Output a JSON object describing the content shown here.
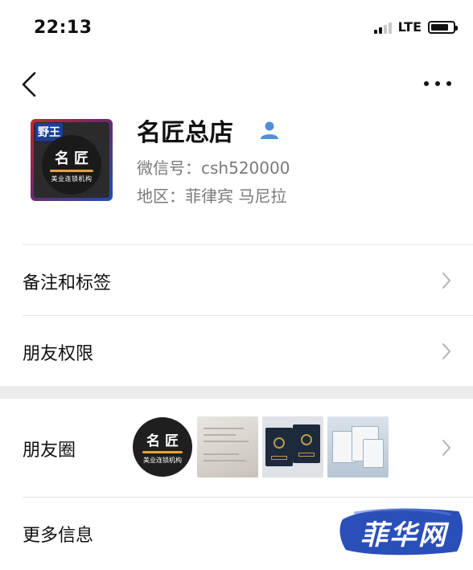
{
  "status_bar": {
    "time": "22:13",
    "network": "LTE",
    "battery_level": 0.8
  },
  "nav": {
    "back_icon": "chevron-left-icon",
    "more_icon": "more-dots-icon"
  },
  "profile": {
    "name": "名匠总店",
    "wechat_id": "微信号：csh520000",
    "region": "地区：菲律宾 马尼拉",
    "avatar": {
      "tag": "野王",
      "title": "名匠",
      "subtitle": "美业连锁机构"
    },
    "verify_icon": "person-icon"
  },
  "rows": {
    "remarks_label": "备注和标签",
    "permissions_label": "朋友权限",
    "moments_label": "朋友圈",
    "more_info_label": "更多信息"
  },
  "moments": {
    "thumb1_title": "名匠",
    "thumb1_subtitle": "美业连锁机构"
  },
  "watermark": {
    "text": "菲华网"
  },
  "colors": {
    "text_primary": "#111111",
    "text_secondary": "#7a7a7a",
    "divider": "#e6e6e6",
    "chevron": "#b2b2b2",
    "verify": "#4e8fd6",
    "watermark_bg": "#2a4fb8"
  }
}
